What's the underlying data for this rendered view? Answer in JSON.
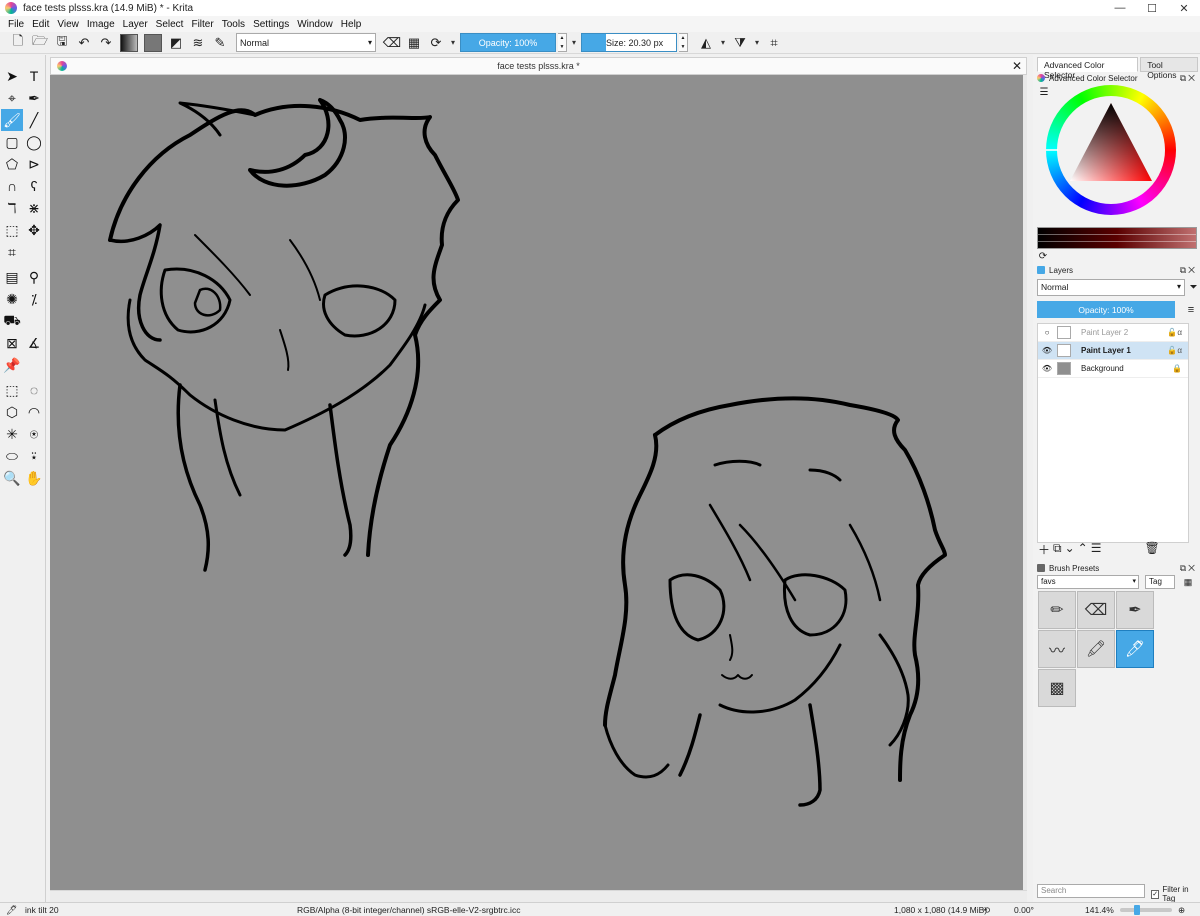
{
  "window": {
    "title": "face tests plsss.kra (14.9 MiB)  * - Krita",
    "minimize": "—",
    "maximize": "☐",
    "close": "✕"
  },
  "menu": [
    "File",
    "Edit",
    "View",
    "Image",
    "Layer",
    "Select",
    "Filter",
    "Tools",
    "Settings",
    "Window",
    "Help"
  ],
  "toolbar": {
    "blend_mode": "Normal",
    "opacity_label": "Opacity: 100%",
    "size_label": "Size: 20.30 px"
  },
  "document": {
    "tab_title": "face tests plsss.kra *",
    "close": "✕"
  },
  "dock": {
    "tabs": [
      "Advanced Color Selector",
      "Tool Options"
    ],
    "color_selector_title": "Advanced Color Selector",
    "layers_title": "Layers",
    "layers_blend": "Normal",
    "layers_opacity": "Opacity:  100%",
    "layers": [
      {
        "name": "Paint Layer 2",
        "visible": false,
        "selected": false
      },
      {
        "name": "Paint Layer 1",
        "visible": true,
        "selected": true
      },
      {
        "name": "Background",
        "visible": true,
        "selected": false
      }
    ],
    "brush_presets_title": "Brush Presets",
    "preset_filter": "favs",
    "preset_tag": "Tag",
    "search_placeholder": "Search",
    "filter_in_tag": "Filter in Tag"
  },
  "status": {
    "tool": "ink tilt 20",
    "color_model": "RGB/Alpha (8-bit integer/channel)  sRGB-elle-V2-srgbtrc.icc",
    "image_size": "1,080 x 1,080 (14.9 MiB)",
    "rotation": "0.00°",
    "zoom": "141.4%"
  },
  "colors": {
    "accent": "#46a8e6",
    "canvas": "#8f8f8f"
  }
}
